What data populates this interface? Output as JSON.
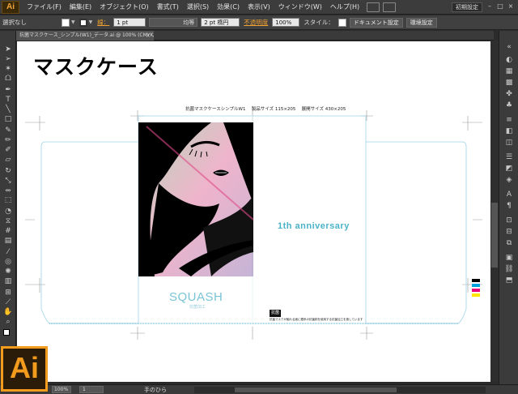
{
  "app": {
    "logo": "Ai",
    "workspace": "初期設定"
  },
  "menu": [
    "ファイル(F)",
    "編集(E)",
    "オブジェクト(O)",
    "書式(T)",
    "選択(S)",
    "効果(C)",
    "表示(V)",
    "ウィンドウ(W)",
    "ヘルプ(H)"
  ],
  "control": {
    "selection": "選択なし",
    "stroke_label": "線：",
    "stroke_weight": "1 pt",
    "profile": "均等",
    "brush": "2 pt 楕円",
    "opacity_label": "不透明度",
    "opacity": "100%",
    "style_label": "スタイル：",
    "doc_setup": "ドキュメント設定",
    "prefs": "環境設定"
  },
  "doc": {
    "tab": "抗菌マスクケース_シンプル(W1)_データ.ai @ 100% (CMYK/プレビュー)"
  },
  "artboard": {
    "heading": "マスクケース",
    "spec": "抗菌マスクケースシンプルW1　 製品サイズ 115×205　 展開サイズ 430×205",
    "anniversary": "1th anniversary",
    "brand": "SQUASH",
    "brand_sub": "抗菌加工",
    "badge": "抗菌",
    "note": "抗菌マスクが触れる面に銀系の抗菌剤を使用する抗菌加工を施しています"
  },
  "status": {
    "zoom": "100%",
    "page": "1",
    "tool": "手のひら"
  },
  "colors": {
    "accent": "#f29b1d",
    "cyan_text": "#4bb3c8",
    "cut_line": "#9fd3e6"
  }
}
